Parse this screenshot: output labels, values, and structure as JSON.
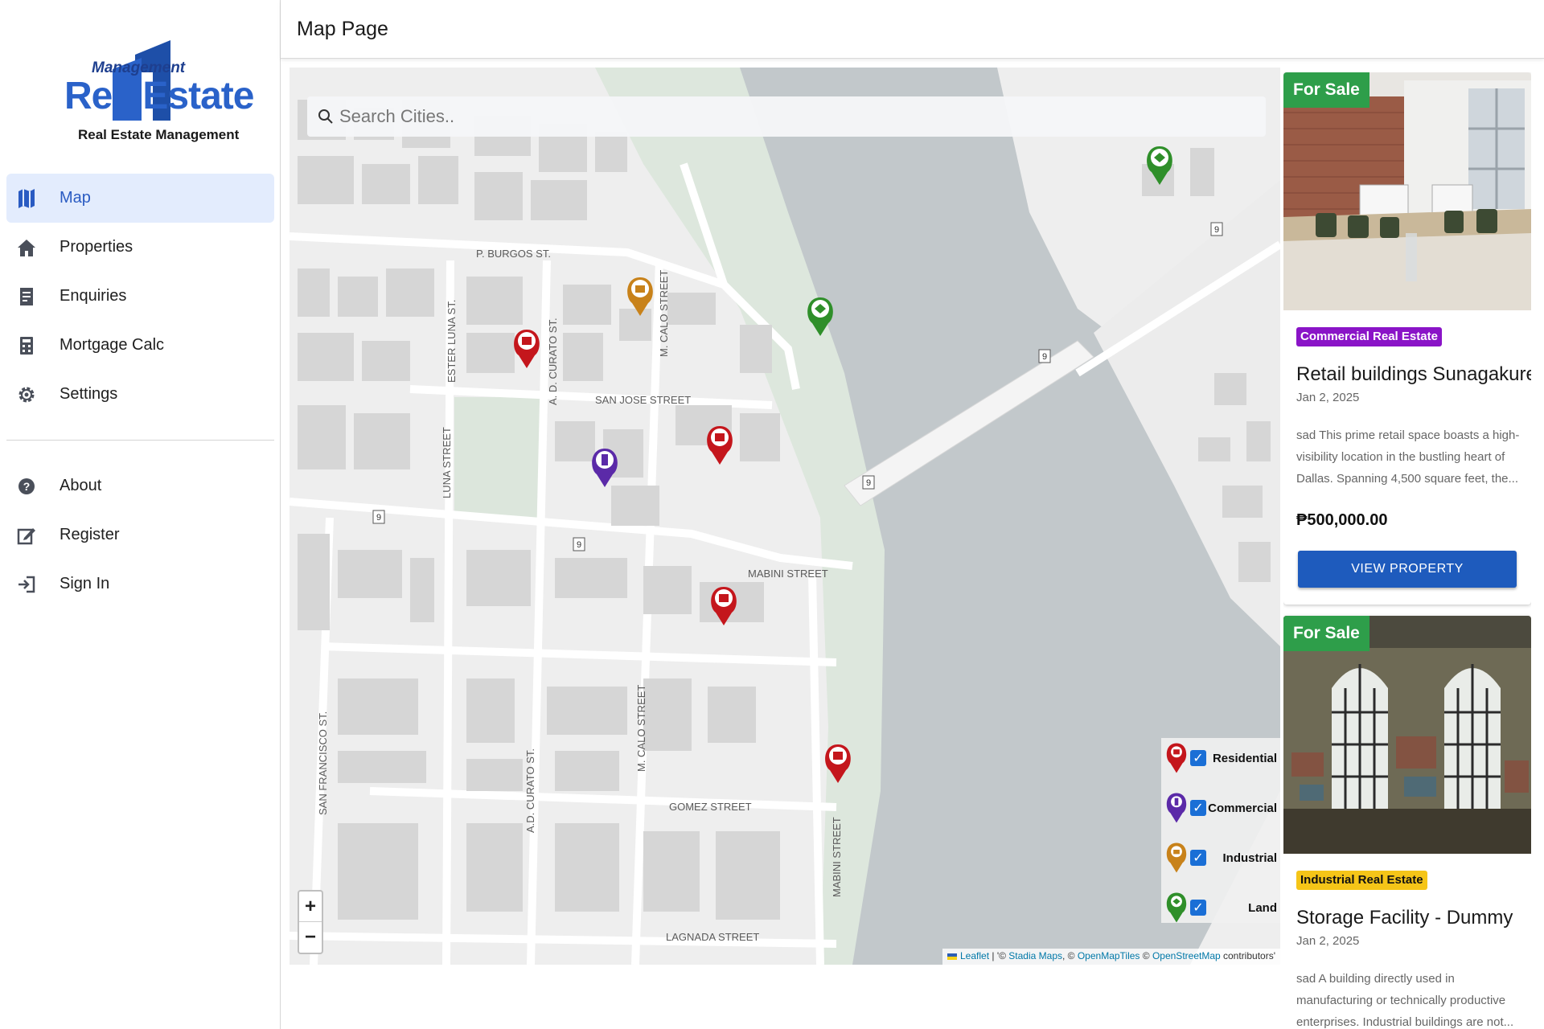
{
  "sidebar": {
    "logo": {
      "management": "Management",
      "brand": "RealEstate",
      "subtitle": "Real Estate Management"
    },
    "nav_primary": [
      {
        "label": "Map",
        "icon": "map-icon",
        "active": true
      },
      {
        "label": "Properties",
        "icon": "home-icon",
        "active": false
      },
      {
        "label": "Enquiries",
        "icon": "document-icon",
        "active": false
      },
      {
        "label": "Mortgage Calc",
        "icon": "calculator-icon",
        "active": false
      },
      {
        "label": "Settings",
        "icon": "gear-icon",
        "active": false
      }
    ],
    "nav_secondary": [
      {
        "label": "About",
        "icon": "help-icon"
      },
      {
        "label": "Register",
        "icon": "edit-icon"
      },
      {
        "label": "Sign In",
        "icon": "sign-in-icon"
      }
    ]
  },
  "header": {
    "title": "Map Page"
  },
  "map": {
    "search_placeholder": "Search Cities..",
    "zoom_in": "+",
    "zoom_out": "−",
    "street_labels": [
      "P. BURGOS ST.",
      "SAN JOSE STREET",
      "MABINI STREET",
      "GOMEZ STREET",
      "LAGNADA STREET",
      "ESTER LUNA ST.",
      "LUNA STREET",
      "A. D. CURATO ST.",
      "A.D. CURATO ST.",
      "M. CALO STREET",
      "M. CALO STREET",
      "SAN FRANCISCO ST.",
      "MABINI STREET"
    ],
    "road_badges": [
      "9",
      "9",
      "9",
      "9",
      "9"
    ],
    "legend": [
      {
        "label": "Residential",
        "color": "#c4161c",
        "checked": true
      },
      {
        "label": "Commercial",
        "color": "#5b2aa8",
        "checked": true
      },
      {
        "label": "Industrial",
        "color": "#c8821a",
        "checked": true
      },
      {
        "label": "Land",
        "color": "#2f8f2a",
        "checked": true
      }
    ],
    "attribution": {
      "leaflet": "Leaflet",
      "sep1": " | '© ",
      "stadia": "Stadia Maps",
      "sep2": ", © ",
      "openmaptiles": "OpenMapTiles",
      "sep3": " © ",
      "osm": "OpenStreetMap",
      "tail": " contributors'"
    }
  },
  "cards": [
    {
      "sale": "For Sale",
      "category": "Commercial Real Estate",
      "category_bg": "#8a14c7",
      "category_color": "#ffffff",
      "title": "Retail buildings Sunagakure...",
      "date": "Jan 2, 2025",
      "description": "sad This prime retail space boasts a high-visibility location in the bustling heart of Dallas. Spanning 4,500 square feet, the...",
      "price": "₱500,000.00",
      "button": "VIEW PROPERTY"
    },
    {
      "sale": "For Sale",
      "category": "Industrial Real Estate",
      "category_bg": "#f5c518",
      "category_color": "#111111",
      "title": "Storage Facility - Dummy",
      "date": "Jan 2, 2025",
      "description": "sad A building directly used in manufacturing or technically productive enterprises. Industrial buildings are not..."
    }
  ],
  "colors": {
    "accent": "#2a5bc2",
    "sale_green": "#2e9e4a",
    "button_blue": "#1e5bbd",
    "residential": "#c4161c",
    "commercial": "#5b2aa8",
    "industrial": "#c8821a",
    "land": "#2f8f2a"
  }
}
